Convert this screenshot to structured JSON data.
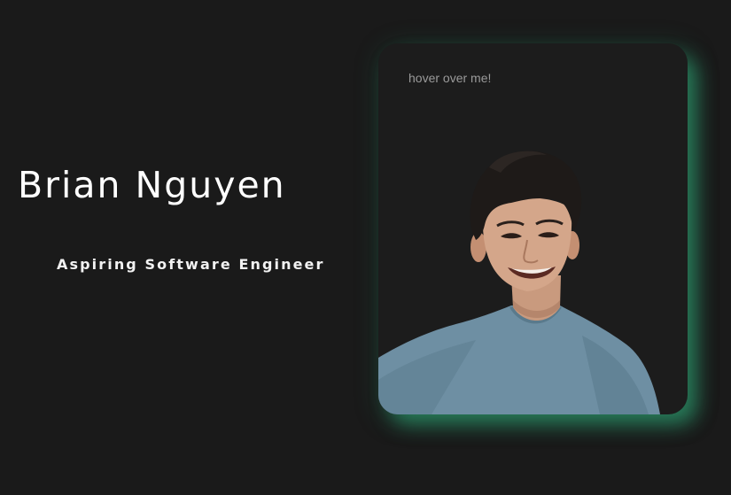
{
  "hero": {
    "name": "Brian Nguyen",
    "tagline": "Aspiring Software Engineer"
  },
  "card": {
    "hint": "hover over me!",
    "glow_color": "#2eaa78"
  },
  "colors": {
    "background": "#1a1a1a",
    "card_background": "#1c1c1c",
    "text": "#ffffff",
    "hint_text": "#9a9a9a"
  }
}
